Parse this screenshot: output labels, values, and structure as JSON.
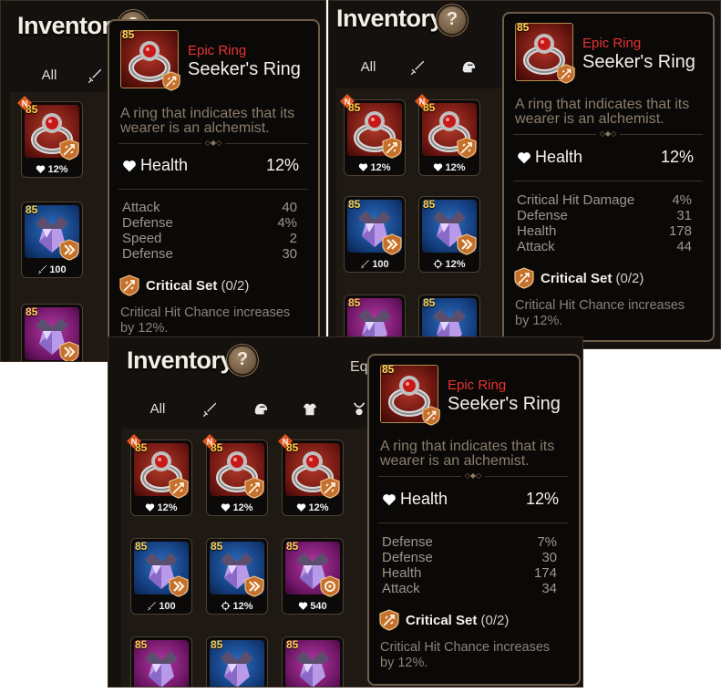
{
  "inventory": {
    "title": "Inventory",
    "help_symbol": "?",
    "equip_label_partial": "Equ",
    "tab_all": "All"
  },
  "item": {
    "level": "85",
    "rarity": "Epic Ring",
    "name": "Seeker's Ring",
    "description_line1": "A ring that indicates that its",
    "description_line2": "wearer is an alchemist.",
    "main_stat_label": "Health",
    "main_stat_value": "12%",
    "set_name": "Critical Set",
    "set_count": "(0/2)",
    "set_desc_line1": "Critical Hit Chance increases",
    "set_desc_line2": "by 12%."
  },
  "tooltips": [
    {
      "substats": [
        {
          "label": "Attack",
          "value": "40"
        },
        {
          "label": "Defense",
          "value": "4%"
        },
        {
          "label": "Speed",
          "value": "2"
        },
        {
          "label": "Defense",
          "value": "30"
        }
      ]
    },
    {
      "substats": [
        {
          "label": "Critical Hit Damage",
          "value": "4%"
        },
        {
          "label": "Defense",
          "value": "31"
        },
        {
          "label": "Health",
          "value": "178"
        },
        {
          "label": "Attack",
          "value": "44"
        }
      ]
    },
    {
      "substats": [
        {
          "label": "Defense",
          "value": "7%"
        },
        {
          "label": "Defense",
          "value": "30"
        },
        {
          "label": "Health",
          "value": "174"
        },
        {
          "label": "Attack",
          "value": "34"
        }
      ]
    }
  ],
  "grid_items": {
    "new_tag": "N",
    "level": "85",
    "ring_stat": "12%",
    "blue_attack_stat": "100",
    "blue_crit_stat": "12%",
    "purple_health_stat": "540"
  },
  "colors": {
    "rarity_epic": "#e83333",
    "level_gold": "#ffd24a",
    "new_tag_bg": "#e0561f",
    "badge_orange": "#d8742a"
  },
  "icons": {
    "help": "question-mark-icon",
    "sword_tab": "sword-icon",
    "helmet_tab": "helmet-icon",
    "armor_tab": "armor-icon",
    "necklace_tab": "necklace-icon",
    "health": "heart-icon",
    "critical_set": "critical-set-icon",
    "speed_set": "speed-set-icon",
    "hit_set": "hit-set-icon",
    "attack": "sword-icon",
    "crit": "crosshair-icon"
  }
}
